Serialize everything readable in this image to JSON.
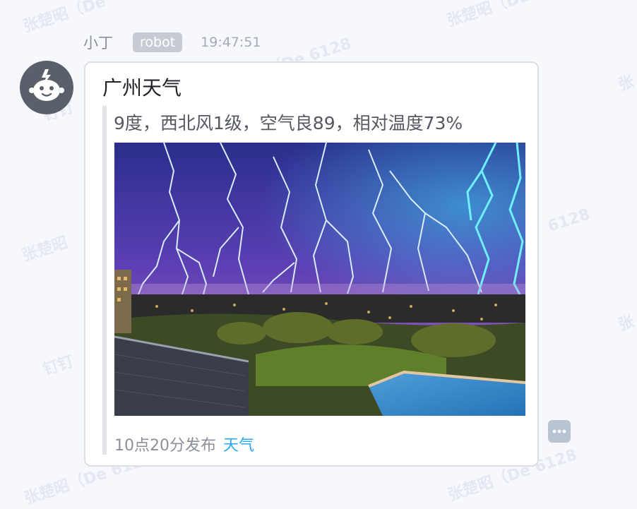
{
  "watermark": {
    "text": "张楚昭（De 6128",
    "sub": "钉钉"
  },
  "message": {
    "sender_name": "小丁",
    "sender_badge": "robot",
    "timestamp": "19:47:51",
    "avatar_icon": "robot-avatar-icon"
  },
  "card": {
    "title": "广州天气",
    "description": "9度，西北风1级，空气良89，相对温度73%",
    "image": "lightning-storm-over-city-photo",
    "footer_text": "10点20分发布",
    "footer_link": "天气"
  },
  "actions": {
    "more_icon": "more-horizontal-icon"
  },
  "colors": {
    "page_bg": "#f6f8fd",
    "card_border": "#dcdfe6",
    "link": "#2ea7f2",
    "badge_bg": "#c7ccd4",
    "avatar_bg": "#595f6b"
  }
}
